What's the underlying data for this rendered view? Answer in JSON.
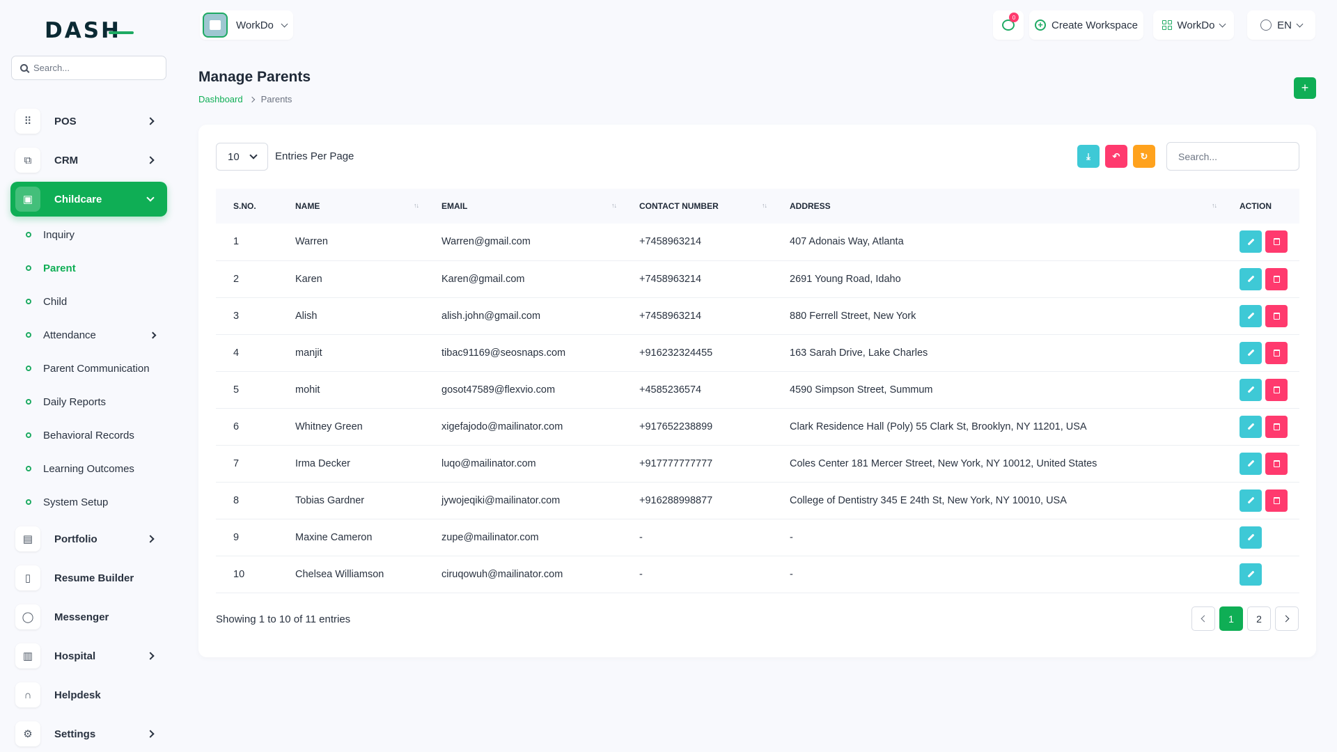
{
  "app": {
    "logo_text": "DASH"
  },
  "sidebar": {
    "search_placeholder": "Search...",
    "items": [
      {
        "label": "POS",
        "icon": "grid-dots-icon",
        "has_chevron": true
      },
      {
        "label": "CRM",
        "icon": "layers-icon",
        "has_chevron": true
      },
      {
        "label": "Childcare",
        "icon": "building-icon",
        "has_chevron": true,
        "active": true
      },
      {
        "label": "Portfolio",
        "icon": "briefcase-icon",
        "has_chevron": true
      },
      {
        "label": "Resume Builder",
        "icon": "file-icon",
        "has_chevron": false
      },
      {
        "label": "Messenger",
        "icon": "chat-icon",
        "has_chevron": false
      },
      {
        "label": "Hospital",
        "icon": "hospital-icon",
        "has_chevron": true
      },
      {
        "label": "Helpdesk",
        "icon": "headset-icon",
        "has_chevron": false
      },
      {
        "label": "Settings",
        "icon": "gear-icon",
        "has_chevron": true
      }
    ],
    "subitems": [
      {
        "label": "Inquiry"
      },
      {
        "label": "Parent",
        "active": true
      },
      {
        "label": "Child"
      },
      {
        "label": "Attendance",
        "has_chevron": true
      },
      {
        "label": "Parent Communication"
      },
      {
        "label": "Daily Reports"
      },
      {
        "label": "Behavioral Records"
      },
      {
        "label": "Learning Outcomes"
      },
      {
        "label": "System Setup"
      }
    ]
  },
  "topbar": {
    "workspace_label": "WorkDo",
    "notification_count": "0",
    "create_workspace_label": "Create Workspace",
    "workdo_label": "WorkDo",
    "language_label": "EN"
  },
  "header": {
    "title": "Manage Parents",
    "breadcrumb": {
      "home": "Dashboard",
      "current": "Parents"
    },
    "add_label": "+"
  },
  "table_controls": {
    "entries_value": "10",
    "entries_label": "Entries Per Page",
    "search_placeholder": "Search..."
  },
  "table": {
    "columns": [
      "S.NO.",
      "NAME",
      "EMAIL",
      "CONTACT NUMBER",
      "ADDRESS",
      "ACTION"
    ],
    "rows": [
      {
        "sno": "1",
        "name": "Warren",
        "email": "Warren@gmail.com",
        "contact": "+7458963214",
        "address": "407 Adonais Way, Atlanta",
        "can_delete": true
      },
      {
        "sno": "2",
        "name": "Karen",
        "email": "Karen@gmail.com",
        "contact": "+7458963214",
        "address": "2691 Young Road, Idaho",
        "can_delete": true
      },
      {
        "sno": "3",
        "name": "Alish",
        "email": "alish.john@gmail.com",
        "contact": "+7458963214",
        "address": "880 Ferrell Street, New York",
        "can_delete": true
      },
      {
        "sno": "4",
        "name": "manjit",
        "email": "tibac91169@seosnaps.com",
        "contact": "+916232324455",
        "address": "163 Sarah Drive, Lake Charles",
        "can_delete": true
      },
      {
        "sno": "5",
        "name": "mohit",
        "email": "gosot47589@flexvio.com",
        "contact": "+4585236574",
        "address": "4590 Simpson Street, Summum",
        "can_delete": true
      },
      {
        "sno": "6",
        "name": "Whitney Green",
        "email": "xigefajodo@mailinator.com",
        "contact": "+917652238899",
        "address": "Clark Residence Hall (Poly) 55 Clark St, Brooklyn, NY 11201, USA",
        "can_delete": true
      },
      {
        "sno": "7",
        "name": "Irma Decker",
        "email": "luqo@mailinator.com",
        "contact": "+917777777777",
        "address": "Coles Center 181 Mercer Street, New York, NY 10012, United States",
        "can_delete": true
      },
      {
        "sno": "8",
        "name": "Tobias Gardner",
        "email": "jywojeqiki@mailinator.com",
        "contact": "+916288998877",
        "address": "College of Dentistry 345 E 24th St, New York, NY 10010, USA",
        "can_delete": true
      },
      {
        "sno": "9",
        "name": "Maxine Cameron",
        "email": "zupe@mailinator.com",
        "contact": "-",
        "address": "-",
        "can_delete": false
      },
      {
        "sno": "10",
        "name": "Chelsea Williamson",
        "email": "ciruqowuh@mailinator.com",
        "contact": "-",
        "address": "-",
        "can_delete": false
      }
    ]
  },
  "footer": {
    "showing_text": "Showing 1 to 10 of 11 entries",
    "pages": [
      "1",
      "2"
    ],
    "current_page": "1"
  },
  "colors": {
    "primary": "#0fae55",
    "info": "#3ec9d6",
    "danger": "#ff3a6e",
    "warning": "#ffa21d"
  }
}
